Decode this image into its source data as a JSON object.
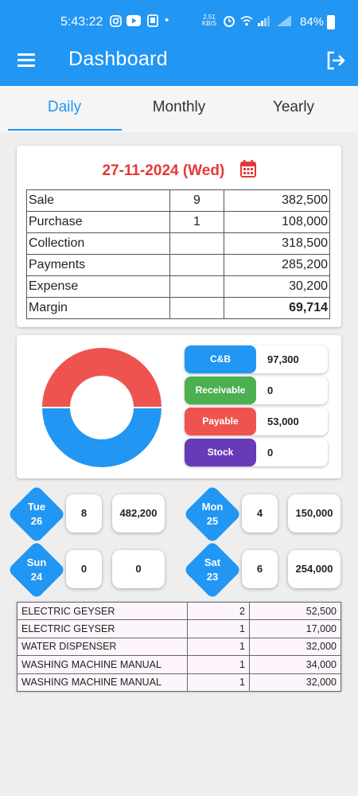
{
  "status_bar": {
    "time": "5:43:22",
    "speed_value": "2.51",
    "speed_unit": "KB/S",
    "battery": "84%"
  },
  "app": {
    "title": "Dashboard",
    "primary_color": "#2196f3"
  },
  "tabs": [
    {
      "label": "Daily",
      "active": true
    },
    {
      "label": "Monthly",
      "active": false
    },
    {
      "label": "Yearly",
      "active": false
    }
  ],
  "summary": {
    "date": "27-11-2024 (Wed)",
    "rows": [
      {
        "label": "Sale",
        "count": "9",
        "amount": "382,500"
      },
      {
        "label": "Purchase",
        "count": "1",
        "amount": "108,000"
      },
      {
        "label": "Collection",
        "count": "",
        "amount": "318,500"
      },
      {
        "label": "Payments",
        "count": "",
        "amount": "285,200"
      },
      {
        "label": "Expense",
        "count": "",
        "amount": "30,200"
      },
      {
        "label": "Margin",
        "count": "",
        "amount": "69,714"
      }
    ]
  },
  "donut": {
    "segments": [
      {
        "fraction": 0.5,
        "color": "#ef5350"
      },
      {
        "fraction": 0.5,
        "color": "#2196f3"
      }
    ]
  },
  "stats": [
    {
      "label": "C&B",
      "value": "97,300",
      "color": "#2196f3"
    },
    {
      "label": "Receivable",
      "value": "0",
      "color": "#4caf50"
    },
    {
      "label": "Payable",
      "value": "53,000",
      "color": "#ef5350"
    },
    {
      "label": "Stock",
      "value": "0",
      "color": "#673ab7"
    }
  ],
  "days": [
    {
      "day": "Tue",
      "date": "26",
      "count": "8",
      "amount": "482,200"
    },
    {
      "day": "Mon",
      "date": "25",
      "count": "4",
      "amount": "150,000"
    },
    {
      "day": "Sun",
      "date": "24",
      "count": "0",
      "amount": "0"
    },
    {
      "day": "Sat",
      "date": "23",
      "count": "6",
      "amount": "254,000"
    }
  ],
  "items": [
    {
      "name": "ELECTRIC GEYSER",
      "qty": "2",
      "amount": "52,500"
    },
    {
      "name": "ELECTRIC GEYSER",
      "qty": "1",
      "amount": "17,000"
    },
    {
      "name": "WATER DISPENSER",
      "qty": "1",
      "amount": "32,000"
    },
    {
      "name": "WASHING MACHINE MANUAL",
      "qty": "1",
      "amount": "34,000"
    },
    {
      "name": "WASHING MACHINE MANUAL",
      "qty": "1",
      "amount": "32,000"
    }
  ]
}
